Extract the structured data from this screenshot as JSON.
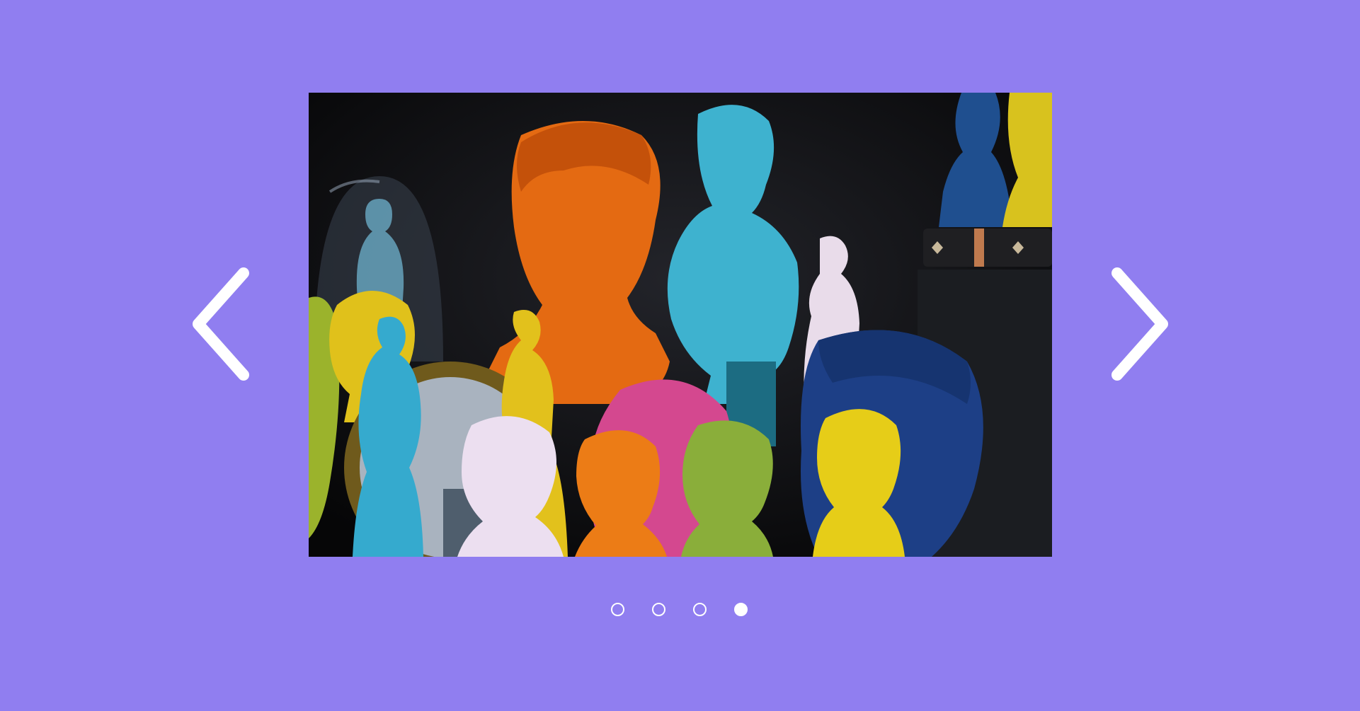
{
  "carousel": {
    "slide_count": 4,
    "active_index": 3,
    "image_subject": "colorful-classical-statue-busts",
    "colors": {
      "page_background": "#907ef0",
      "arrow": "#ffffff",
      "dot": "#ffffff"
    },
    "controls": {
      "prev_icon": "chevron-left-icon",
      "next_icon": "chevron-right-icon"
    }
  }
}
